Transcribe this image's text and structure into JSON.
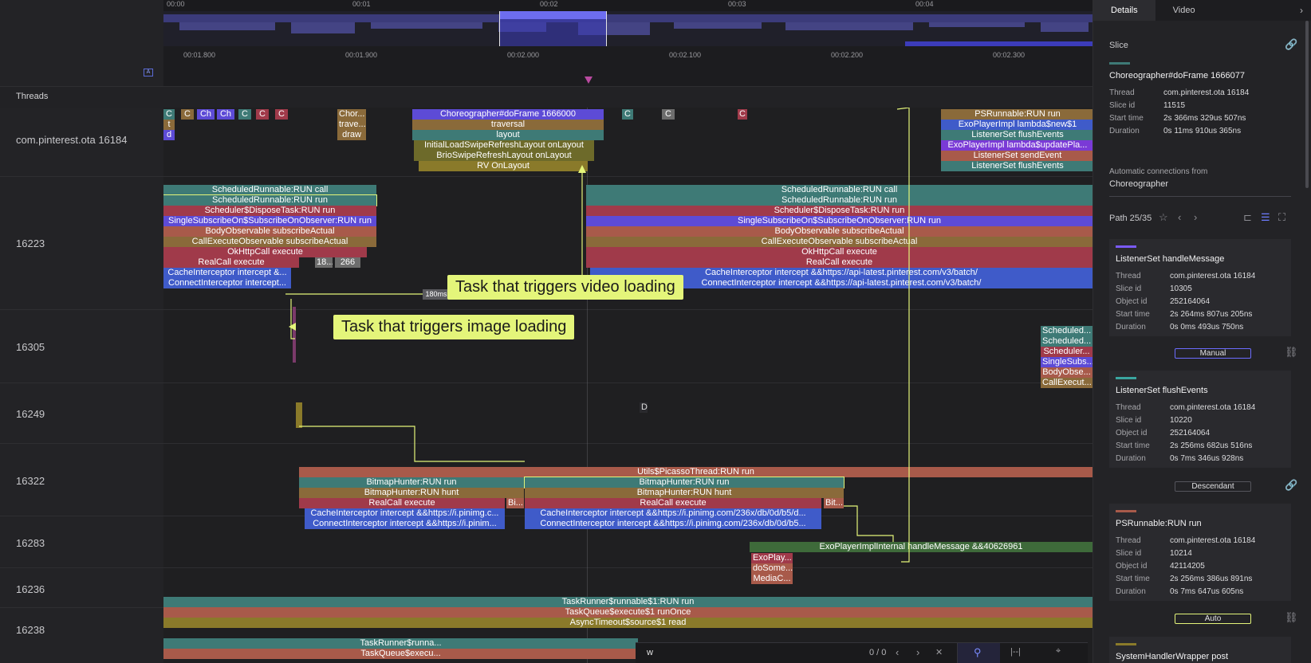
{
  "ruler": {
    "overview_ticks": [
      "00:00",
      "00:01",
      "00:02",
      "00:03",
      "00:04"
    ],
    "ticks": [
      "00:01.800",
      "00:01.900",
      "00:02.000",
      "00:02.100",
      "00:02.200",
      "00:02.300"
    ]
  },
  "threads_header": "Threads",
  "tracks": [
    {
      "label": "com.pinterest.ota 16184"
    },
    {
      "label": "16223"
    },
    {
      "label": "16305"
    },
    {
      "label": "16249"
    },
    {
      "label": "16322"
    },
    {
      "label": "16283"
    },
    {
      "label": "16236"
    },
    {
      "label": "16238"
    }
  ],
  "callouts": {
    "video": "Task that triggers video loading",
    "image": "Task that triggers image loading",
    "gap": "180ms"
  },
  "slices": {
    "main": [
      "Choreographer#doFrame 1666000",
      "traversal",
      "layout",
      "InitialLoadSwipeRefreshLayout onLayout",
      "BrioSwipeRefreshLayout onLayout",
      "RV OnLayout",
      "PSRunnable:RUN run",
      "ExoPlayerImpl lambda$new$1",
      "ListenerSet flushEvents",
      "ExoPlayerImpl lambda$updatePla...",
      "ListenerSet sendEvent",
      "ListenerSet flushEvents",
      "Chor...",
      "trave...",
      "draw"
    ],
    "t16223_left": [
      "ScheduledRunnable:RUN call",
      "ScheduledRunnable:RUN run",
      "Scheduler$DisposeTask:RUN run",
      "SingleSubscribeOn$SubscribeOnObserver:RUN run",
      "BodyObservable subscribeActual",
      "CallExecuteObservable subscribeActual",
      "OkHttpCall execute",
      "RealCall execute",
      "CacheInterceptor intercept &...",
      "ConnectInterceptor intercept...",
      "18...",
      "266"
    ],
    "t16223_right": [
      "ScheduledRunnable:RUN call",
      "ScheduledRunnable:RUN run",
      "Scheduler$DisposeTask:RUN run",
      "SingleSubscribeOn$SubscribeOnObserver:RUN run",
      "BodyObservable subscribeActual",
      "CallExecuteObservable subscribeActual",
      "OkHttpCall execute",
      "RealCall execute",
      "CacheInterceptor intercept &&https://api-latest.pinterest.com/v3/batch/",
      "ConnectInterceptor intercept &&https://api-latest.pinterest.com/v3/batch/"
    ],
    "t16305": [
      "Scheduled...",
      "Scheduled...",
      "Scheduler...",
      "SingleSubs...",
      "BodyObse...",
      "CallExecut..."
    ],
    "t16249": [
      "D"
    ],
    "t16322": [
      "Utils$PicassoThread:RUN run",
      "BitmapHunter:RUN run",
      "BitmapHunter:RUN run",
      "BitmapHunter:RUN hunt",
      "BitmapHunter:RUN hunt",
      "RealCall execute",
      "RealCall execute",
      "CacheInterceptor intercept &&https://i.pinimg.c...",
      "CacheInterceptor intercept &&https://i.pinimg.com/236x/db/0d/b5/d...",
      "ConnectInterceptor intercept &&https://i.pinim...",
      "ConnectInterceptor intercept &&https://i.pinimg.com/236x/db/0d/b5...",
      "Bi...",
      "Bit..."
    ],
    "t16283": [
      "ExoPlayerImplInternal handleMessage &&40626961",
      "ExoPlay...",
      "doSome...",
      "MediaC..."
    ],
    "t16236": [
      "TaskRunner$runnable$1:RUN run",
      "TaskQueue$execute$1 runOnce",
      "AsyncTimeout$source$1 read"
    ],
    "t16238": [
      "TaskRunner$runna...",
      "TaskQueue$execu..."
    ]
  },
  "panel": {
    "tabs": [
      "Details",
      "Video"
    ],
    "section": "Slice",
    "selected": {
      "title": "Choreographer#doFrame 1666077",
      "thread": "com.pinterest.ota 16184",
      "slice_id": "11515",
      "start": "2s 366ms 329us 507ns",
      "duration": "0s 11ms 910us 365ns"
    },
    "auto_conn_label": "Automatic connections from",
    "auto_conn_value": "Choreographer",
    "path": "Path 25/35",
    "labels": {
      "thread": "Thread",
      "slice_id": "Slice id",
      "object_id": "Object id",
      "start": "Start time",
      "duration": "Duration"
    },
    "cards": [
      {
        "title": "ListenerSet handleMessage",
        "thread": "com.pinterest.ota 16184",
        "slice_id": "10305",
        "object_id": "252164064",
        "start": "2s 264ms 807us 205ns",
        "duration": "0s 0ms 493us 750ns",
        "bar": "#7a5af8"
      },
      {
        "title": "ListenerSet flushEvents",
        "thread": "com.pinterest.ota 16184",
        "slice_id": "10220",
        "object_id": "252164064",
        "start": "2s 256ms 682us 516ns",
        "duration": "0s 7ms 346us 928ns",
        "bar": "#3aa6a0"
      },
      {
        "title": "PSRunnable:RUN run",
        "thread": "com.pinterest.ota 16184",
        "slice_id": "10214",
        "object_id": "42114205",
        "start": "2s 256ms 386us 891ns",
        "duration": "0s 7ms 647us 605ns",
        "bar": "#a85a4a"
      }
    ],
    "pills": [
      "Manual",
      "Descendant",
      "Auto"
    ],
    "last_card_title": "SystemHandlerWrapper post"
  },
  "search": {
    "value": "w",
    "count": "0 / 0"
  },
  "colors": {
    "accent": "#e4f57a",
    "teal": "#3e7a76",
    "purple": "#5d4bd6",
    "brown": "#8a6a3a",
    "red": "#a03a4a",
    "blue": "#3f5bc9"
  }
}
